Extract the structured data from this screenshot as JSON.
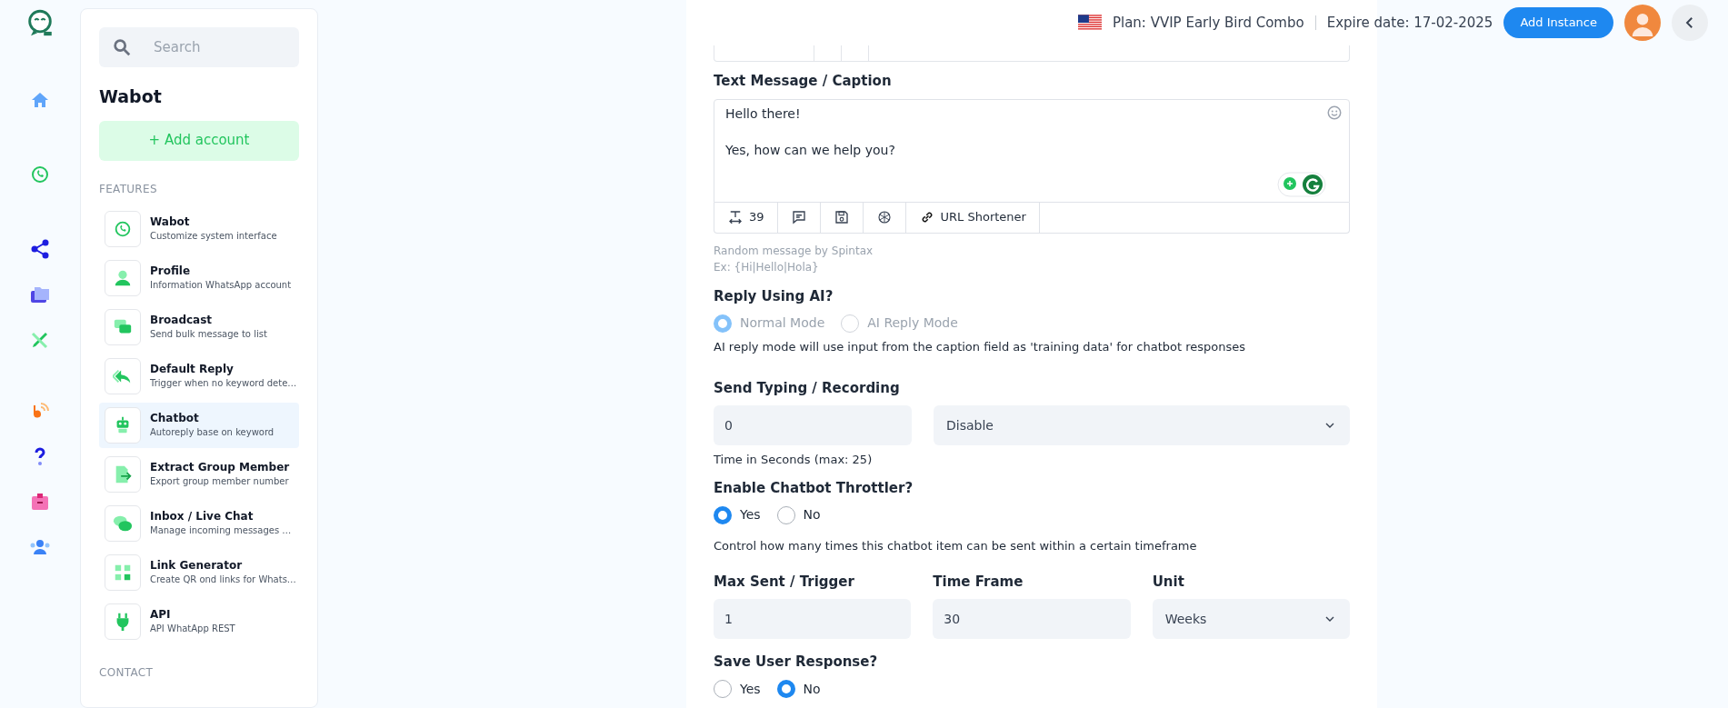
{
  "topbar": {
    "plan": "Plan: VVIP Early Bird Combo",
    "expire": "Expire date: 17-02-2025",
    "add_button": "Add Instance"
  },
  "sidebar": {
    "search": {
      "placeholder": "Search"
    },
    "title": "Wabot",
    "add_button": "+ Add account",
    "sections": [
      {
        "heading": "FEATURES",
        "items": [
          {
            "title": "Wabot",
            "subtitle": "Customize system interface",
            "selected": false
          },
          {
            "title": "Profile",
            "subtitle": "Information WhatsApp account",
            "selected": false
          },
          {
            "title": "Broadcast",
            "subtitle": "Send bulk message to list",
            "selected": false
          },
          {
            "title": "Default Reply",
            "subtitle": "Trigger when no keyword dete…",
            "selected": false
          },
          {
            "title": "Chatbot",
            "subtitle": "Autoreply base on keyword",
            "selected": true
          },
          {
            "title": "Extract Group Member",
            "subtitle": "Export group member number",
            "selected": false
          },
          {
            "title": "Inbox / Live Chat",
            "subtitle": "Manage incoming messages …",
            "selected": false
          },
          {
            "title": "Link Generator",
            "subtitle": "Create QR ond links for Whats…",
            "selected": false
          },
          {
            "title": "API",
            "subtitle": "API WhatApp REST",
            "selected": false
          }
        ]
      },
      {
        "heading": "CONTACT"
      }
    ]
  },
  "form": {
    "caption": {
      "label": "Text Message / Caption",
      "value": "Hello there!\n\nYes, how can we help you?",
      "counter": "39",
      "url_button": "URL Shortener",
      "hint": "Random message by Spintax",
      "example": "Ex: {Hi|Hello|Hola}"
    },
    "reply_ai": {
      "label": "Reply Using AI?",
      "disabled": true,
      "options": [
        {
          "label": "Normal Mode",
          "selected": true
        },
        {
          "label": "AI Reply Mode",
          "selected": false
        }
      ],
      "help": "AI reply mode will use input from the caption field as 'training data' for chatbot responses"
    },
    "typing": {
      "label": "Send Typing / Recording",
      "seconds": "0",
      "mode": "Disable",
      "help": "Time in Seconds (max: 25)"
    },
    "throttler": {
      "label": "Enable Chatbot Throttler?",
      "options": [
        {
          "label": "Yes",
          "selected": true
        },
        {
          "label": "No",
          "selected": false
        }
      ],
      "help": "Control how many times this chatbot item can be sent within a certain timeframe"
    },
    "limits": [
      {
        "label": "Max Sent / Trigger",
        "value": "1",
        "kind": "input"
      },
      {
        "label": "Time Frame",
        "value": "30",
        "kind": "input"
      },
      {
        "label": "Unit",
        "value": "Weeks",
        "kind": "select"
      }
    ],
    "save_response": {
      "label": "Save User Response?",
      "options": [
        {
          "label": "Yes",
          "selected": false
        },
        {
          "label": "No",
          "selected": true
        }
      ]
    }
  }
}
